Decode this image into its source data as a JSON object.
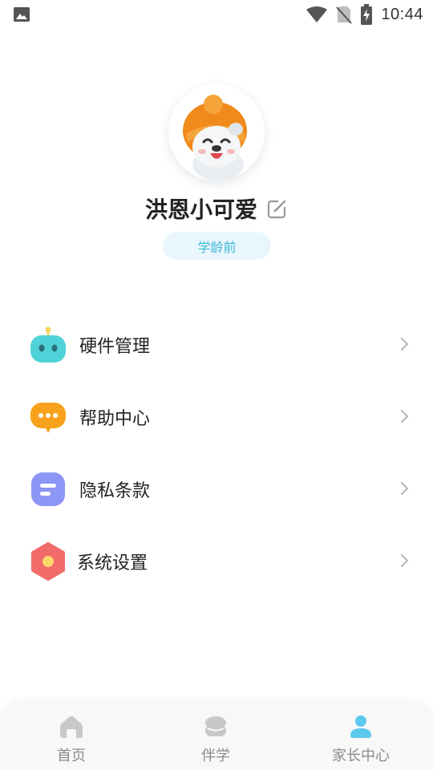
{
  "status_bar": {
    "time": "10:44",
    "left_icon": "image-notification-icon",
    "right_icons": [
      "wifi-icon",
      "no-sim-icon",
      "battery-charging-icon"
    ]
  },
  "profile": {
    "name": "洪恩小可爱",
    "age_group": "学龄前",
    "avatar_icon": "bear-with-hat-avatar"
  },
  "menu": {
    "items": [
      {
        "label": "硬件管理",
        "icon": "robot-icon",
        "color": "#4fd3d9"
      },
      {
        "label": "帮助中心",
        "icon": "chat-bubble-icon",
        "color": "#f8a21b"
      },
      {
        "label": "隐私条款",
        "icon": "document-icon",
        "color": "#8c96f5"
      },
      {
        "label": "系统设置",
        "icon": "settings-icon",
        "color": "#f26b6b"
      }
    ]
  },
  "bottom_nav": {
    "tabs": [
      {
        "label": "首页",
        "icon": "home-icon",
        "active": false
      },
      {
        "label": "伴学",
        "icon": "companion-icon",
        "active": false
      },
      {
        "label": "家长中心",
        "icon": "parent-icon",
        "active": true
      }
    ],
    "active_color": "#5cc8ee",
    "inactive_color": "#c8c8c8"
  }
}
